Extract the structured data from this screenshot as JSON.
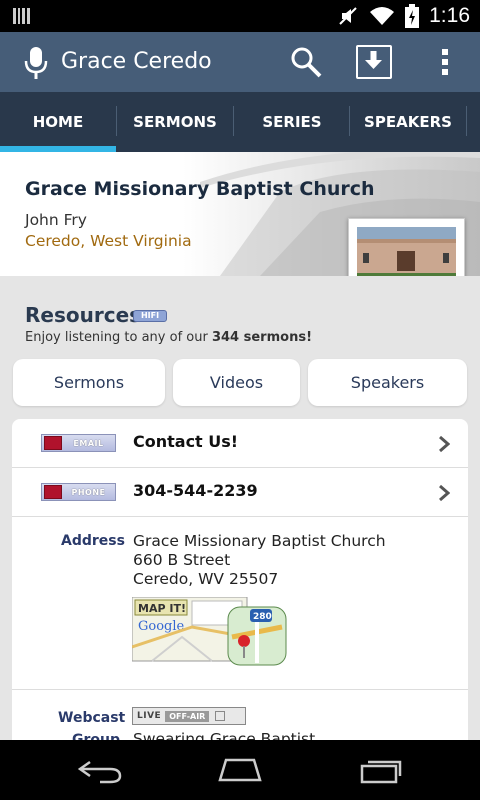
{
  "status": {
    "time": "1:16"
  },
  "actionbar": {
    "title": "Grace Ceredo"
  },
  "tabs": [
    {
      "label": "HOME",
      "active": true
    },
    {
      "label": "SERMONS"
    },
    {
      "label": "SERIES"
    },
    {
      "label": "SPEAKERS"
    }
  ],
  "church": {
    "name": "Grace Missionary Baptist Church",
    "pastor": "John Fry",
    "location": "Ceredo, West Virginia"
  },
  "resources": {
    "title": "Resources",
    "badge": "HIFI",
    "subtitle_prefix": "Enjoy listening to any of our ",
    "subtitle_bold": "344 sermons!",
    "buttons": [
      "Sermons",
      "Videos",
      "Speakers"
    ]
  },
  "contact": {
    "email_tag": "EMAIL",
    "email_label": "Contact Us!",
    "phone_tag": "PHONE",
    "phone_number": "304-544-2239",
    "address_label": "Address",
    "address_lines": [
      "Grace Missionary Baptist Church",
      "660 B Street",
      "Ceredo, WV 25507"
    ],
    "map_badge": "MAP IT!",
    "map_brand": "Google",
    "map_route": "280",
    "webcast_label": "Webcast",
    "webcast_live": "LIVE",
    "webcast_status": "OFF-AIR",
    "group_label": "Group",
    "group_value": "Swearing Grace Baptist"
  },
  "colors": {
    "actionbar": "#465d78",
    "tabbar": "#29384b",
    "tab_indicator": "#33b5e5",
    "location": "#a16a10"
  }
}
